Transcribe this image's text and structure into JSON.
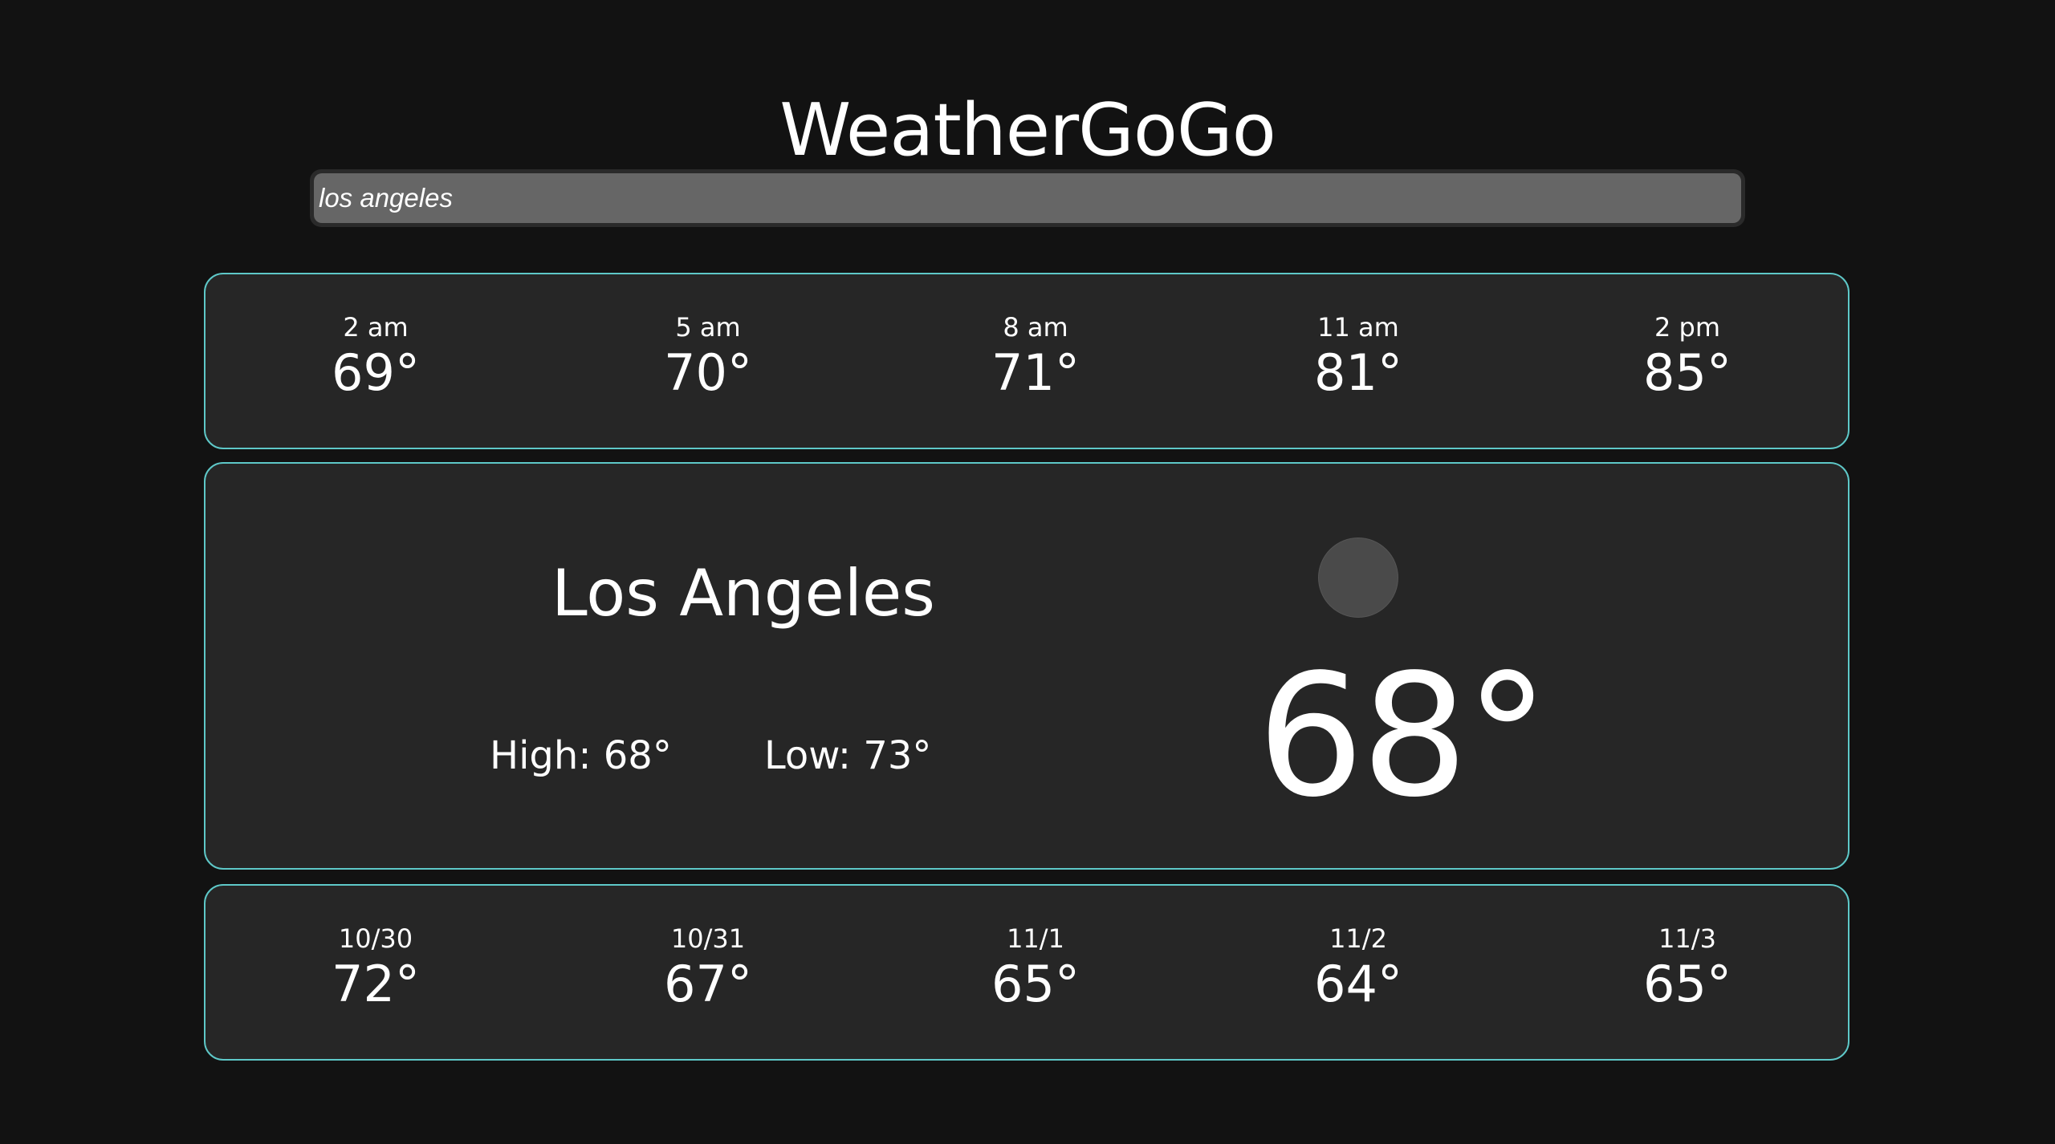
{
  "app": {
    "title": "WeatherGoGo"
  },
  "search": {
    "value": "los angeles"
  },
  "hourly": [
    {
      "time": "2 am",
      "temp": "69°"
    },
    {
      "time": "5 am",
      "temp": "70°"
    },
    {
      "time": "8 am",
      "temp": "71°"
    },
    {
      "time": "11 am",
      "temp": "81°"
    },
    {
      "time": "2 pm",
      "temp": "85°"
    }
  ],
  "current": {
    "city": "Los Angeles",
    "high": "High: 68°",
    "low": "Low: 73°",
    "temp": "68°",
    "icon": "weather-condition-icon"
  },
  "daily": [
    {
      "date": "10/30",
      "temp": "72°"
    },
    {
      "date": "10/31",
      "temp": "67°"
    },
    {
      "date": "11/1",
      "temp": "65°"
    },
    {
      "date": "11/2",
      "temp": "64°"
    },
    {
      "date": "11/3",
      "temp": "65°"
    }
  ],
  "colors": {
    "background": "#121212",
    "card": "#262626",
    "accent_border": "#5ec8c8",
    "input": "#666666"
  }
}
